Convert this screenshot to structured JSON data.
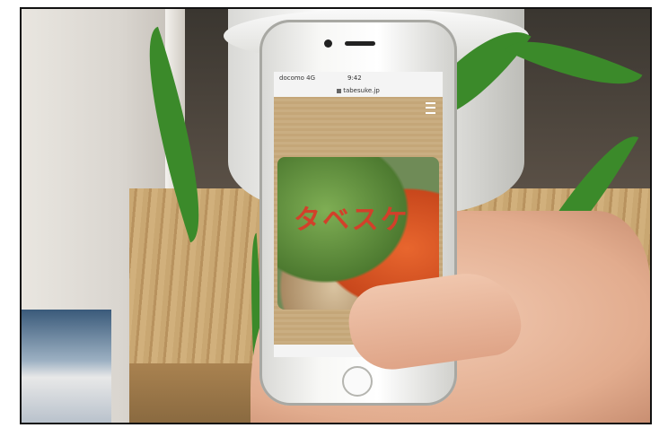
{
  "phone": {
    "carrier": "docomo 4G",
    "time": "9:42",
    "url": "tabesuke.jp"
  },
  "site": {
    "logo_text": "タベスケ"
  }
}
